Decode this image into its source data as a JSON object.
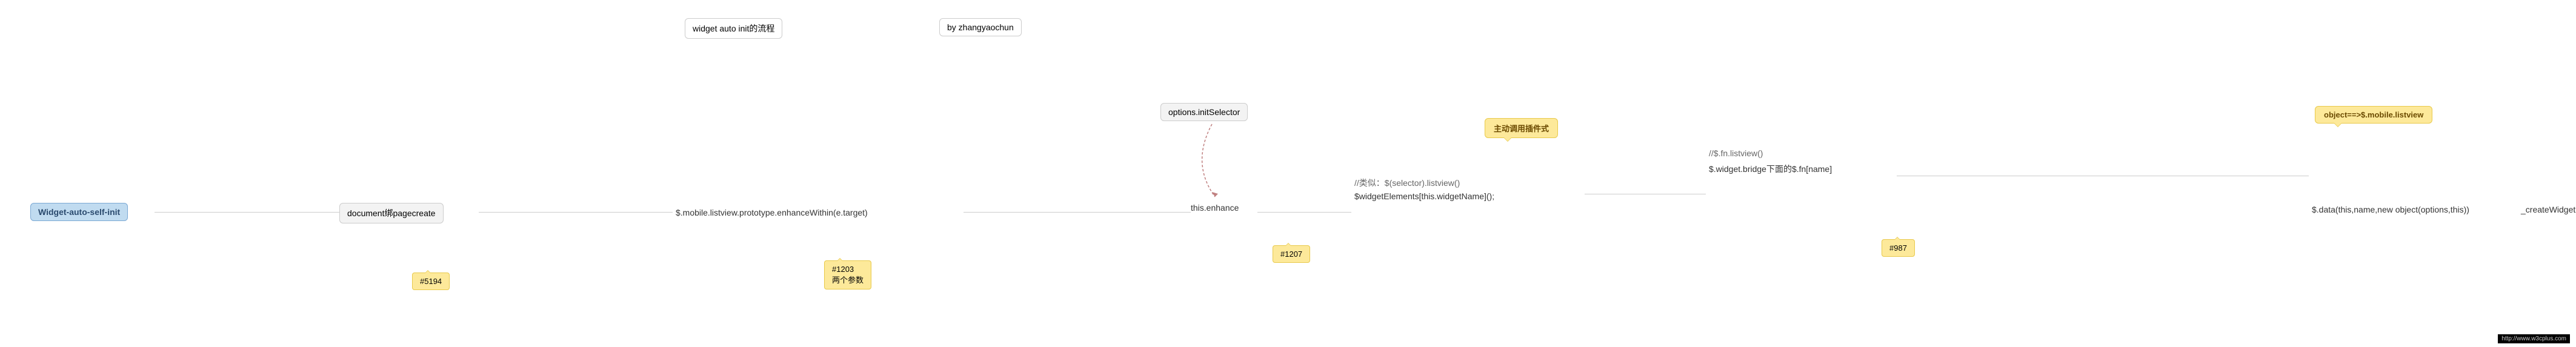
{
  "header": {
    "title": "widget auto init的流程",
    "author": "by zhangyaochun"
  },
  "nodes": {
    "root": "Widget-auto-self-init",
    "n1": "document绑pagecreate",
    "n2": "$.mobile.listview.prototype.enhanceWithin(e.target)",
    "n3": "options.initSelector",
    "enhance": "this.enhance",
    "widget_call": "//类似：$(selector).listview()\n$widgetElements[this.widgetName]();",
    "bridge": "//$.fn.listview()\n$.widget.bridge下面的$.fn[name]",
    "data_call": "$.data(this,name,new object(options,this))",
    "create": "_createWidget"
  },
  "speech": {
    "plugin": "主动调用插件式",
    "object": "object==>$.mobile.listview"
  },
  "notes": {
    "n5194": "#5194",
    "n1203a": "#1203",
    "n1203b": "两个参数",
    "n1207": "#1207",
    "n987": "#987"
  },
  "footer": {
    "url": "http://www.w3cplus.com"
  }
}
